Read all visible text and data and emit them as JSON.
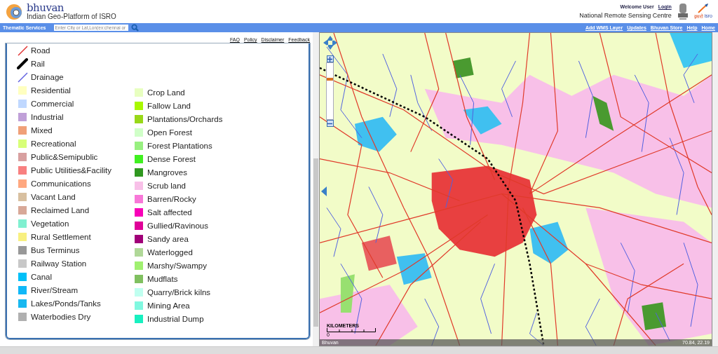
{
  "header": {
    "logo_title": "bhuvan",
    "subtitle": "Indian Geo-Platform of ISRO",
    "welcome": "Welcome User",
    "login": "Login",
    "organisation": "National Remote Sensing Centre",
    "isro_hindi": "इसरो",
    "isro_english": "isro"
  },
  "nav_bar": {
    "menu": "Thematic Services",
    "search": {
      "placeholder": "Enter City or Lat,Lon(ex:chennai or"
    },
    "links": [
      "Add WMS Layer",
      "Updates",
      "Bhuvan Store",
      "Help",
      "Home"
    ]
  },
  "info_links": [
    "FAQ",
    "Policy",
    "Disclaimer",
    "Feedback"
  ],
  "legend": {
    "column_1": [
      {
        "kind": "line",
        "label": "Road",
        "color": "#e03030"
      },
      {
        "kind": "rail",
        "label": "Rail",
        "color": "#000000"
      },
      {
        "kind": "line",
        "label": "Drainage",
        "color": "#6060e0"
      },
      {
        "kind": "swatch",
        "label": "Residential",
        "color": "#ffffc0"
      },
      {
        "kind": "swatch",
        "label": "Commercial",
        "color": "#c0d8ff"
      },
      {
        "kind": "swatch",
        "label": "Industrial",
        "color": "#c0a0d8"
      },
      {
        "kind": "swatch",
        "label": "Mixed",
        "color": "#f0a078"
      },
      {
        "kind": "swatch",
        "label": "Recreational",
        "color": "#d8ff78"
      },
      {
        "kind": "swatch",
        "label": "Public&Semipublic",
        "color": "#d8a0a0"
      },
      {
        "kind": "swatch",
        "label": "Public Utilities&Facility",
        "color": "#f88080"
      },
      {
        "kind": "swatch",
        "label": "Communications",
        "color": "#ffa880"
      },
      {
        "kind": "swatch",
        "label": "Vacant Land",
        "color": "#d8c0a0"
      },
      {
        "kind": "swatch",
        "label": "Reclaimed Land",
        "color": "#d8a898"
      },
      {
        "kind": "swatch",
        "label": "Vegetation",
        "color": "#80f0d0"
      },
      {
        "kind": "swatch",
        "label": "Rural Settlement",
        "color": "#f8f080"
      },
      {
        "kind": "swatch",
        "label": "Bus Terminus",
        "color": "#989898"
      },
      {
        "kind": "swatch",
        "label": "Railway Station",
        "color": "#c8c8c8"
      },
      {
        "kind": "swatch",
        "label": "Canal",
        "color": "#00c0f8"
      },
      {
        "kind": "swatch",
        "label": "River/Stream",
        "color": "#10b8f8"
      },
      {
        "kind": "swatch",
        "label": "Lakes/Ponds/Tanks",
        "color": "#18b8f0"
      },
      {
        "kind": "swatch",
        "label": "Waterbodies Dry",
        "color": "#b0b0b0"
      }
    ],
    "column_2": [
      {
        "kind": "swatch",
        "label": "Crop Land",
        "color": "#e8ffc0"
      },
      {
        "kind": "swatch",
        "label": "Fallow Land",
        "color": "#a8f800"
      },
      {
        "kind": "swatch",
        "label": "Plantations/Orchards",
        "color": "#98d818"
      },
      {
        "kind": "swatch",
        "label": "Open Forest",
        "color": "#d0ffc8"
      },
      {
        "kind": "swatch",
        "label": "Forest Plantations",
        "color": "#98f080"
      },
      {
        "kind": "swatch",
        "label": "Dense Forest",
        "color": "#40f020"
      },
      {
        "kind": "swatch",
        "label": "Mangroves",
        "color": "#309820"
      },
      {
        "kind": "swatch",
        "label": "Scrub land",
        "color": "#f8c0e8"
      },
      {
        "kind": "swatch",
        "label": "Barren/Rocky",
        "color": "#f878d8"
      },
      {
        "kind": "swatch",
        "label": "Salt affected",
        "color": "#f800b8"
      },
      {
        "kind": "swatch",
        "label": "Gullied/Ravinous",
        "color": "#e00098"
      },
      {
        "kind": "swatch",
        "label": "Sandy area",
        "color": "#a00078"
      },
      {
        "kind": "swatch",
        "label": "Waterlogged",
        "color": "#b0d898"
      },
      {
        "kind": "swatch",
        "label": "Marshy/Swampy",
        "color": "#a0f070"
      },
      {
        "kind": "swatch",
        "label": "Mudflats",
        "color": "#80c060"
      },
      {
        "kind": "swatch",
        "label": "Quarry/Brick kilns",
        "color": "#c0fff0"
      },
      {
        "kind": "swatch",
        "label": "Mining Area",
        "color": "#80f8e0"
      },
      {
        "kind": "swatch",
        "label": "Industrial Dump",
        "color": "#18f0c0"
      }
    ]
  },
  "map": {
    "zoom": {
      "level": 0.72
    },
    "scale_label": "KILOMETERS",
    "scale_zero": "0",
    "attribution": "Bhuvan",
    "coordinates": "70.84, 22.19"
  }
}
